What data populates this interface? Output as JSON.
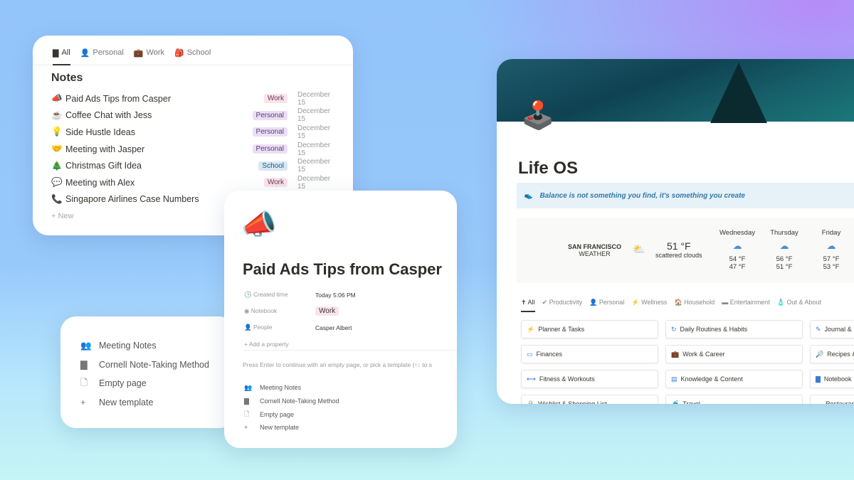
{
  "notes": {
    "tabs": [
      {
        "icon": "book-icon",
        "glyph": "▇",
        "label": "All"
      },
      {
        "icon": "person-icon",
        "glyph": "👤",
        "label": "Personal"
      },
      {
        "icon": "briefcase-icon",
        "glyph": "💼",
        "label": "Work"
      },
      {
        "icon": "backpack-icon",
        "glyph": "🎒",
        "label": "School"
      }
    ],
    "title": "Notes",
    "rows": [
      {
        "emoji": "📣",
        "title": "Paid Ads Tips from Casper",
        "tag": "Work",
        "date": "December 15"
      },
      {
        "emoji": "☕",
        "title": "Coffee Chat with Jess",
        "tag": "Personal",
        "date": "December 15"
      },
      {
        "emoji": "💡",
        "title": "Side Hustle Ideas",
        "tag": "Personal",
        "date": "December 15"
      },
      {
        "emoji": "🤝",
        "title": "Meeting with Jasper",
        "tag": "Personal",
        "date": "December 15"
      },
      {
        "emoji": "🎄",
        "title": "Christmas Gift Idea",
        "tag": "School",
        "date": "December 15"
      },
      {
        "emoji": "💬",
        "title": "Meeting with Alex",
        "tag": "Work",
        "date": "December 15"
      },
      {
        "emoji": "📞",
        "title": "Singapore Airlines Case Numbers",
        "tag": "",
        "date": ""
      }
    ],
    "new_label": "+ New"
  },
  "templates": [
    {
      "glyph": "👥",
      "label": "Meeting Notes"
    },
    {
      "glyph": "▇",
      "label": "Cornell Note-Taking Method"
    },
    {
      "glyph": "🗋",
      "label": "Empty page"
    },
    {
      "glyph": "+",
      "label": "New template"
    }
  ],
  "page": {
    "emoji": "📣",
    "title": "Paid Ads Tips from Casper",
    "props": [
      {
        "key": "Created time",
        "value": "Today 5:06 PM"
      },
      {
        "key": "Notebook",
        "value": "Work"
      },
      {
        "key": "People",
        "value": "Casper Albert"
      }
    ],
    "add_property": "+ Add a property",
    "hint": "Press Enter to continue with an empty page, or pick a template (↑↓ to s"
  },
  "life": {
    "title": "Life OS",
    "quote": "Balance is not something you find, it's something you create",
    "weather": {
      "city": "SAN FRANCISCO",
      "label": "WEATHER",
      "temp": "51 °F",
      "desc": "scattered clouds",
      "days": [
        {
          "name": "Wednesday",
          "hi": "54 °F",
          "lo": "47 °F"
        },
        {
          "name": "Thursday",
          "hi": "56 °F",
          "lo": "51 °F"
        },
        {
          "name": "Friday",
          "hi": "57 °F",
          "lo": "53 °F"
        }
      ]
    },
    "cats": [
      "All",
      "Productivity",
      "Personal",
      "Wellness",
      "Household",
      "Entertainment",
      "Out & About"
    ],
    "buttons": [
      {
        "g": "⚡",
        "l": "Planner & Tasks"
      },
      {
        "g": "↻",
        "l": "Daily Routines & Habits"
      },
      {
        "g": "✎",
        "l": "Journal &"
      },
      {
        "g": "▭",
        "l": "Finances"
      },
      {
        "g": "💼",
        "l": "Work & Career"
      },
      {
        "g": "🔎",
        "l": "Recipes &"
      },
      {
        "g": "⟷",
        "l": "Fitness & Workouts"
      },
      {
        "g": "▤",
        "l": "Knowledge & Content"
      },
      {
        "g": "▇",
        "l": "Notebook"
      },
      {
        "g": "🔒",
        "l": "Wishlist & Shopping List"
      },
      {
        "g": "🧳",
        "l": "Travel"
      },
      {
        "g": "▬",
        "l": "Restaurants"
      }
    ]
  }
}
